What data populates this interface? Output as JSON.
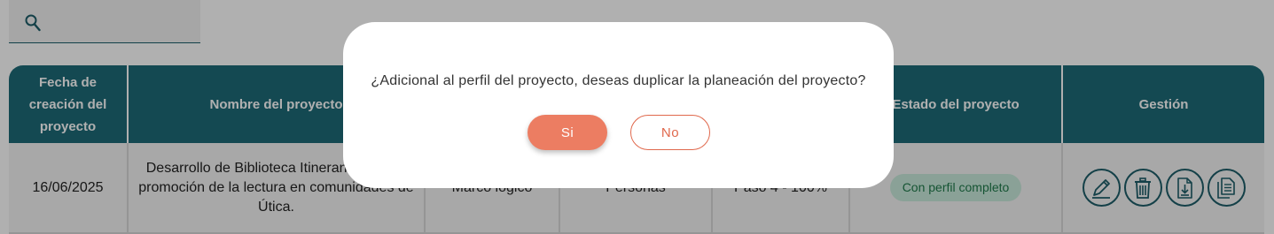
{
  "search": {
    "placeholder": ""
  },
  "table": {
    "headers": [
      "Fecha de creación del proyecto",
      "Nombre del proyecto",
      "",
      "",
      "",
      "Estado del proyecto",
      "Gestión"
    ],
    "rows": [
      {
        "fecha": "16/06/2025",
        "nombre": "Desarrollo de Biblioteca Itinerante para la promoción de la lectura en comunidades de Útica.",
        "metodologia": "Marco lógico",
        "tipo": "Personas",
        "paso": "Paso 4 - 100%",
        "estado": "Con perfil completo"
      }
    ]
  },
  "actions": [
    "edit-icon",
    "trash-icon",
    "download-doc-icon",
    "copy-doc-icon"
  ],
  "dialog": {
    "message": "¿Adicional al perfil del proyecto, deseas duplicar la planeación del proyecto?",
    "yes_label": "Si",
    "no_label": "No"
  },
  "colors": {
    "header_bg": "#1d6b78",
    "accent": "#ec7d62",
    "badge_bg": "#c9eadb",
    "badge_text": "#1f7a4b"
  }
}
